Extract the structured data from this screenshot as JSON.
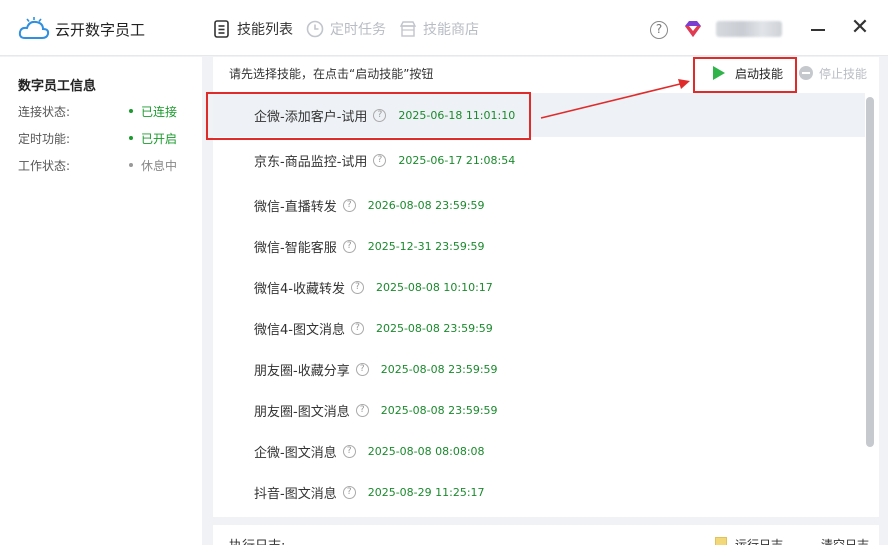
{
  "app": {
    "title": "云开数字员工"
  },
  "tabs": [
    {
      "label": "技能列表",
      "icon": "list-icon",
      "active": true
    },
    {
      "label": "定时任务",
      "icon": "clock-icon",
      "active": false
    },
    {
      "label": "技能商店",
      "icon": "store-icon",
      "active": false
    }
  ],
  "sidebar": {
    "title": "数字员工信息",
    "rows": [
      {
        "label": "连接状态:",
        "value": "已连接",
        "status": "green"
      },
      {
        "label": "定时功能:",
        "value": "已开启",
        "status": "green"
      },
      {
        "label": "工作状态:",
        "value": "休息中",
        "status": "gray"
      }
    ]
  },
  "main": {
    "hint": "请先选择技能，在点击“启动技能”按钮",
    "start_label": "启动技能",
    "stop_label": "停止技能",
    "skills": [
      {
        "name": "企微-添加客户-试用",
        "expire": "2025-06-18 11:01:10",
        "selected": true
      },
      {
        "name": "京东-商品监控-试用",
        "expire": "2025-06-17 21:08:54"
      },
      {
        "name": "微信-直播转发",
        "expire": "2026-08-08 23:59:59"
      },
      {
        "name": "微信-智能客服",
        "expire": "2025-12-31 23:59:59"
      },
      {
        "name": "微信4-收藏转发",
        "expire": "2025-08-08 10:10:17"
      },
      {
        "name": "微信4-图文消息",
        "expire": "2025-08-08 23:59:59"
      },
      {
        "name": "朋友圈-收藏分享",
        "expire": "2025-08-08 23:59:59"
      },
      {
        "name": "朋友圈-图文消息",
        "expire": "2025-08-08 23:59:59"
      },
      {
        "name": "企微-图文消息",
        "expire": "2025-08-08 08:08:08"
      },
      {
        "name": "抖音-图文消息",
        "expire": "2025-08-29 11:25:17"
      }
    ]
  },
  "log": {
    "title": "执行日志:",
    "legend_label": "运行日志",
    "clear_label": "清空日志"
  },
  "colors": {
    "accent_green": "#1a9a2c",
    "play_green": "#2fb44a",
    "annotation_red": "#e02b2b"
  }
}
